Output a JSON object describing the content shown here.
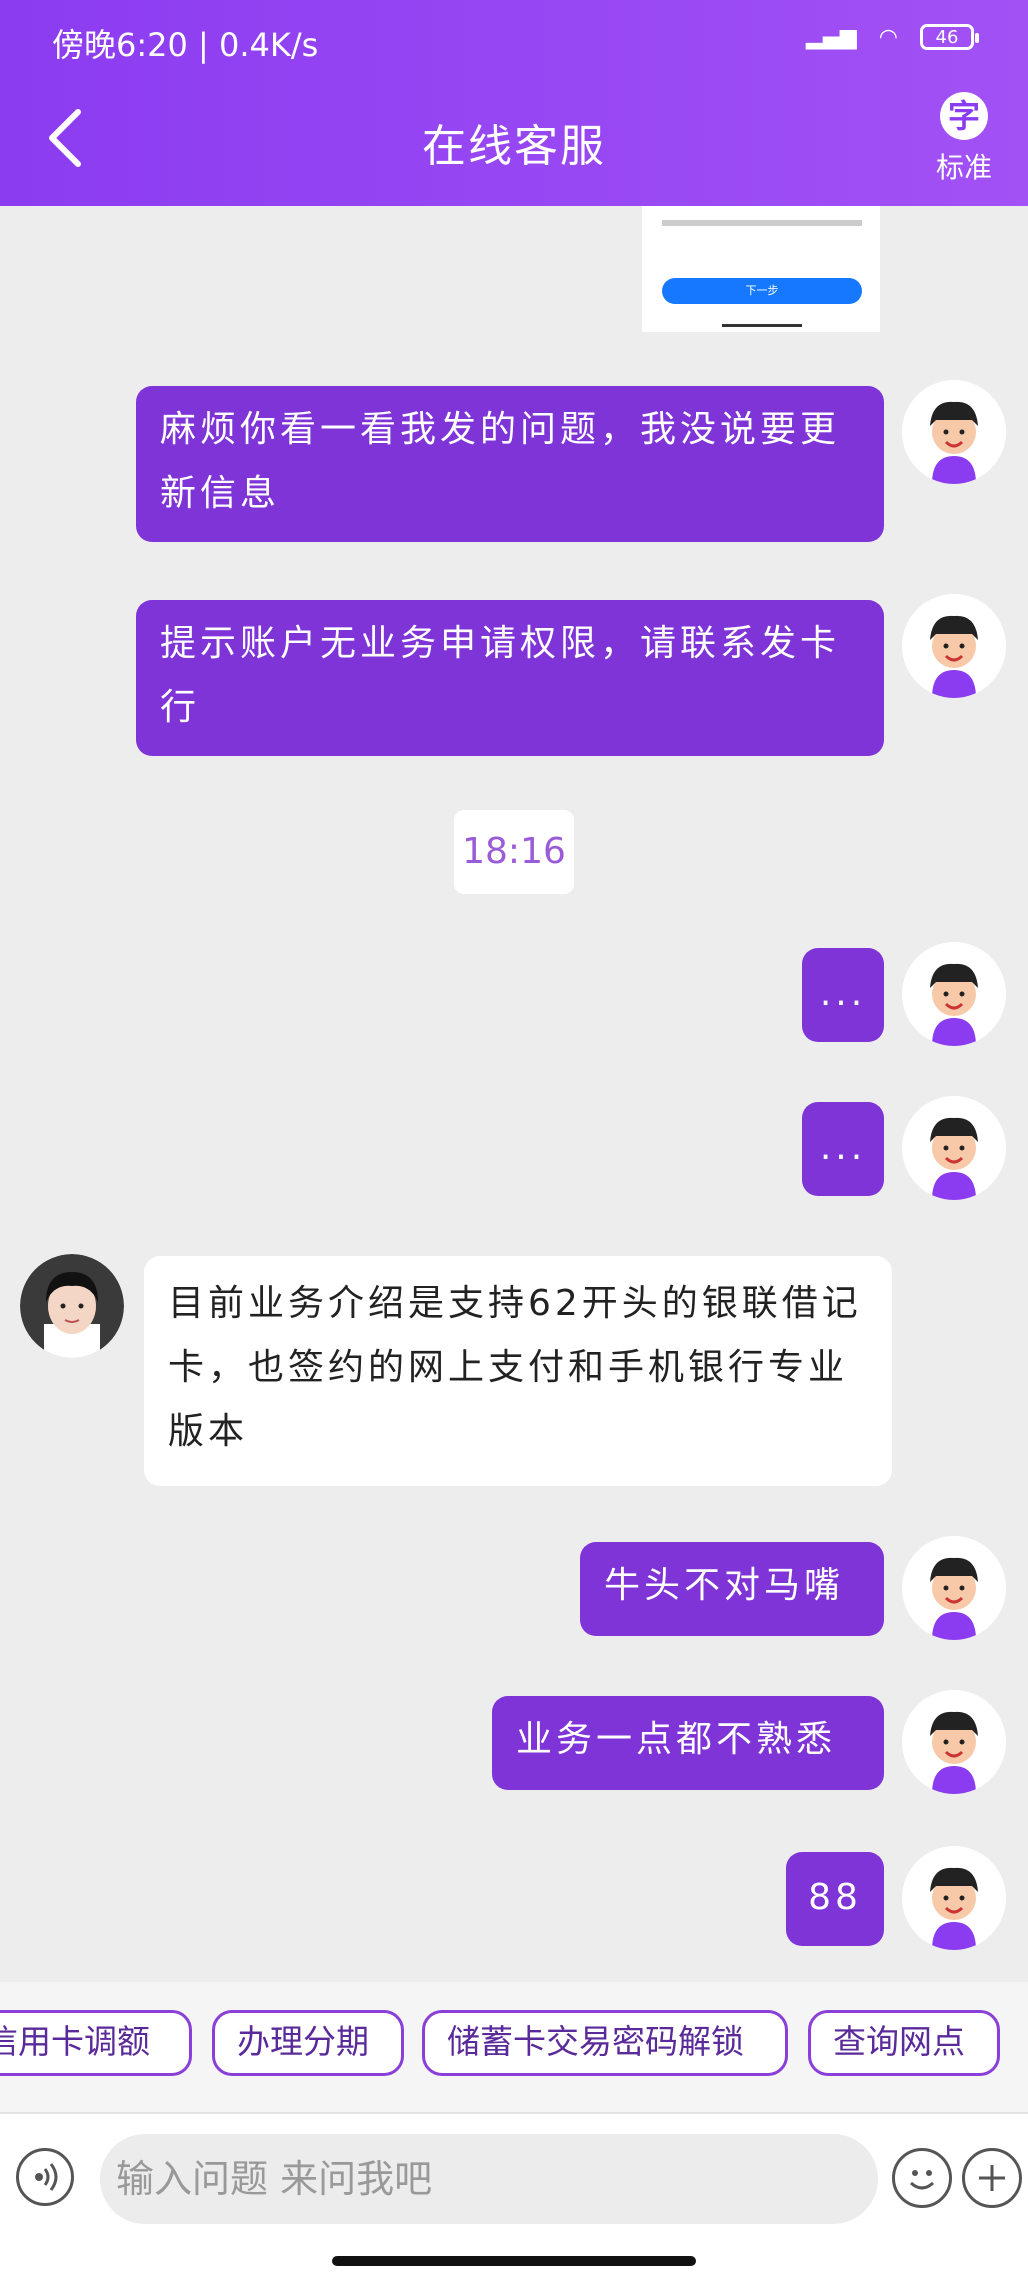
{
  "status_bar": {
    "time": "傍晚6:20 | 0.4K/s",
    "battery": "46"
  },
  "header": {
    "title": "在线客服",
    "font_icon": "字",
    "font_label": "标准"
  },
  "thumbnail": {
    "button": "下一步"
  },
  "messages": {
    "m1": "麻烦你看一看我发的问题，我没说要更新信息",
    "m2": "提示账户无业务申请权限，请联系发卡行",
    "time": "18:16",
    "m3": "...",
    "m4": "...",
    "agent": "目前业务介绍是支持62开头的银联借记卡，也签约的网上支付和手机银行专业版本",
    "m5": "牛头不对马嘴",
    "m6": "业务一点都不熟悉",
    "m7": "88"
  },
  "quick_replies": [
    "信用卡调额",
    "办理分期",
    "储蓄卡交易密码解锁",
    "查询网点"
  ],
  "input": {
    "placeholder": "输入问题 来问我吧"
  },
  "colors": {
    "header": "#8b3cf0",
    "bubble": "#7f34d8",
    "chip_border": "#8a3fd8"
  }
}
